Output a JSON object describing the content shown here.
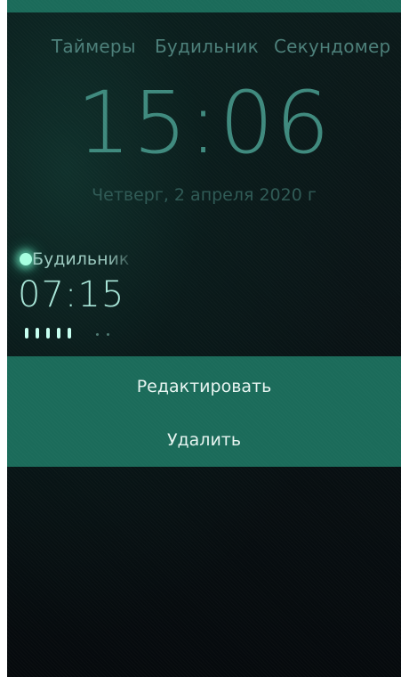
{
  "tabs": [
    {
      "label": "Таймеры"
    },
    {
      "label": "Будильник"
    },
    {
      "label": "Секундомер"
    }
  ],
  "clock": {
    "time": "15:06",
    "date": "Четверг, 2 апреля 2020 г"
  },
  "alarm": {
    "name": "Будильник",
    "time": "07:15",
    "days_active": [
      true,
      true,
      true,
      true,
      true,
      false,
      false
    ]
  },
  "context_menu": {
    "edit_label": "Редактировать",
    "delete_label": "Удалить"
  },
  "colors": {
    "accent": "#1b6b5a",
    "clock_text": "#3f8a7e",
    "tab_text": "#4c7f79",
    "alarm_indicator": "#a6ffe0"
  }
}
